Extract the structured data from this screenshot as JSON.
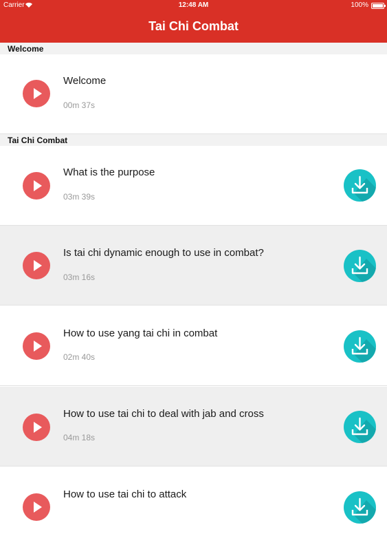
{
  "status_bar": {
    "carrier": "Carrier",
    "time": "12:48 AM",
    "battery": "100%"
  },
  "nav": {
    "title": "Tai Chi Combat"
  },
  "sections": [
    {
      "header": "Welcome",
      "items": [
        {
          "title": "Welcome",
          "duration": "00m 37s"
        }
      ]
    },
    {
      "header": "Tai Chi Combat",
      "items": [
        {
          "title": "What is the purpose",
          "duration": "03m 39s"
        },
        {
          "title": "Is tai chi dynamic enough to use in combat?",
          "duration": "03m 16s"
        },
        {
          "title": "How to use yang tai chi in combat",
          "duration": "02m 40s"
        },
        {
          "title": "How to use tai chi to deal with jab and cross",
          "duration": "04m 18s"
        },
        {
          "title": "How to use tai chi to attack",
          "duration": ""
        }
      ]
    }
  ],
  "icons": {
    "play": "play-icon",
    "download": "download-icon",
    "wifi": "wifi-icon",
    "battery": "battery-icon"
  },
  "colors": {
    "brand_red": "#d93026",
    "play_red": "#e85a5c",
    "download_teal": "#19c1c6"
  }
}
